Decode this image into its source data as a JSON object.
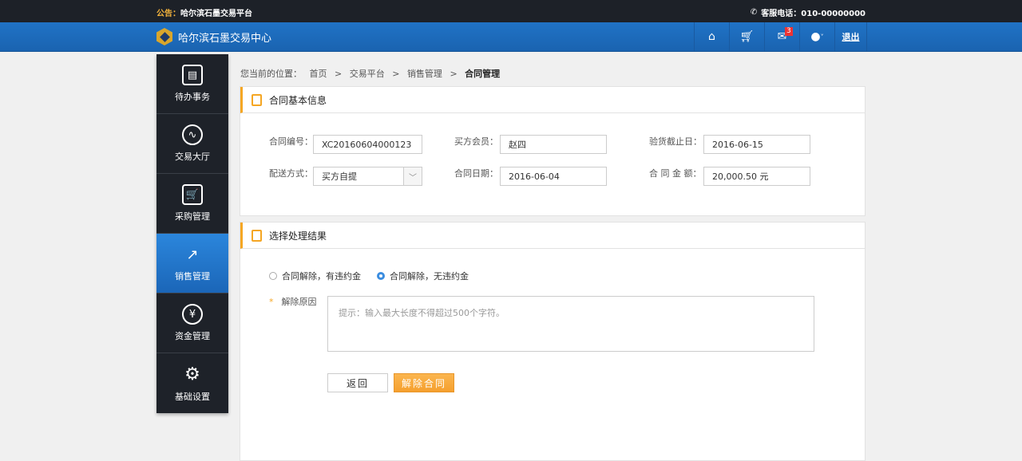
{
  "topbar": {
    "notice_label": "公告：",
    "notice_text": "哈尔滨石墨交易平台",
    "phone_text": "客服电话：010-00000000"
  },
  "nav": {
    "brand": "哈尔滨石墨交易中心",
    "mail_count": "3",
    "logout": "退出"
  },
  "sidebar": {
    "items": [
      {
        "label": "待办事务",
        "icon": "▤"
      },
      {
        "label": "交易大厅",
        "icon": "∿"
      },
      {
        "label": "采购管理",
        "icon": "🛒"
      },
      {
        "label": "销售管理",
        "icon": "↗"
      },
      {
        "label": "资金管理",
        "icon": "¥"
      },
      {
        "label": "基础设置",
        "icon": "⚙"
      }
    ]
  },
  "breadcrumb": {
    "prefix": "您当前的位置：",
    "items": [
      "首页",
      ">",
      "交易平台",
      ">",
      "销售管理",
      ">"
    ],
    "current": "合同管理"
  },
  "basic": {
    "title": "合同基本信息",
    "contract_no_label": "合同编号：",
    "contract_no": "XC20160604000123",
    "buyer_label": "买方会员：",
    "buyer": "赵四",
    "deadline_label": "验货截止日：",
    "deadline": "2016-06-15",
    "delivery_label": "配送方式：",
    "delivery": "买方自提",
    "date_label": "合同日期：",
    "date": "2016-06-04",
    "amount_label": "合 同 金 额：",
    "amount": "20,000.50 元"
  },
  "result": {
    "title": "选择处理结果",
    "option1": "合同解除，有违约金",
    "option2": "合同解除，无违约金",
    "selected": 2,
    "reason_label": "解除原因",
    "required_mark": "*",
    "reason_placeholder": "提示：输入最大长度不得超过500个字符。",
    "back": "返回",
    "submit": "解除合同"
  },
  "colors": {
    "accent": "#f5a623",
    "primary": "#1f6bbf"
  }
}
